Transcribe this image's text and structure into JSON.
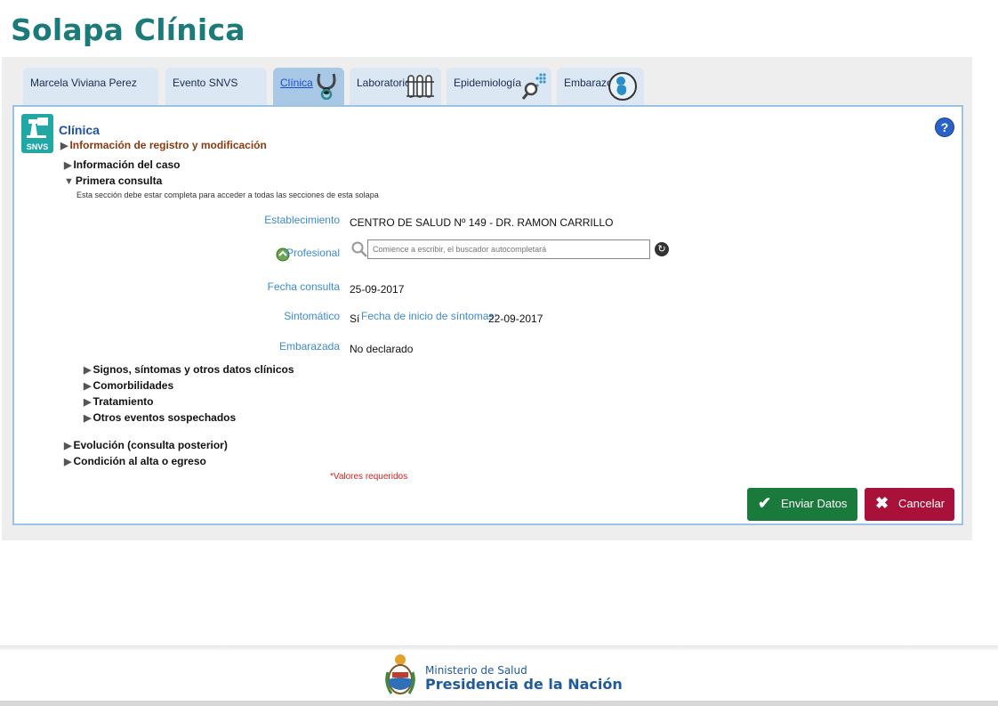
{
  "slide_title": "Solapa Clínica",
  "tabs": [
    {
      "label": "Marcela Viviana Perez",
      "icon": "none"
    },
    {
      "label": "Evento SNVS",
      "icon": "none"
    },
    {
      "label": "Clínica",
      "icon": "stethoscope-icon",
      "active": true
    },
    {
      "label": "Laboratorio",
      "icon": "test-tubes-icon"
    },
    {
      "label": "Epidemiología",
      "icon": "magnifier-dots-icon"
    },
    {
      "label": "Embarazo",
      "icon": "fetus-icon"
    }
  ],
  "panel": {
    "logo_text": "SNVS",
    "title": "Clínica",
    "help_glyph": "?"
  },
  "sections": {
    "registro": "Información de registro y modificación",
    "caso": "Información del caso",
    "primera": "Primera consulta",
    "primera_note": "Esta sección debe estar completa para acceder a todas las secciones de esta solapa",
    "signos": "Signos, síntomas y otros datos clínicos",
    "comorbilidades": "Comorbilidades",
    "tratamiento": "Tratamiento",
    "otros": "Otros eventos sospechados",
    "evolucion": "Evolución (consulta posterior)",
    "condicion": "Condición al alta o egreso"
  },
  "form": {
    "establecimiento_label": "Establecimiento",
    "establecimiento_value": "CENTRO DE SALUD Nº 149 - DR. RAMON CARRILLO",
    "profesional_label": "Profesional",
    "profesional_placeholder": "Comience a escribir, el buscador autocompletará",
    "fecha_consulta_label": "Fecha consulta",
    "fecha_consulta_value": "25-09-2017",
    "sintomatico_label": "Sintomático",
    "sintomatico_value": "Sí",
    "fecha_inicio_label": "Fecha de inicio de síntomas:",
    "fecha_inicio_value": "22-09-2017",
    "embarazada_label": "Embarazada",
    "embarazada_value": "No declarado"
  },
  "required_note": "*Valores requeridos",
  "buttons": {
    "send": "Enviar Datos",
    "cancel": "Cancelar"
  },
  "footer": {
    "ministry": "Ministerio de Salud",
    "presidency": "Presidencia de la Nación"
  },
  "colors": {
    "title_teal": "#1b7b7b",
    "tab_bg": "#dbe7f2",
    "tab_active_bg": "#a9c8e6",
    "label_blue": "#3b8bd0",
    "send_green": "#1a7a3b",
    "cancel_red": "#a8123a"
  }
}
